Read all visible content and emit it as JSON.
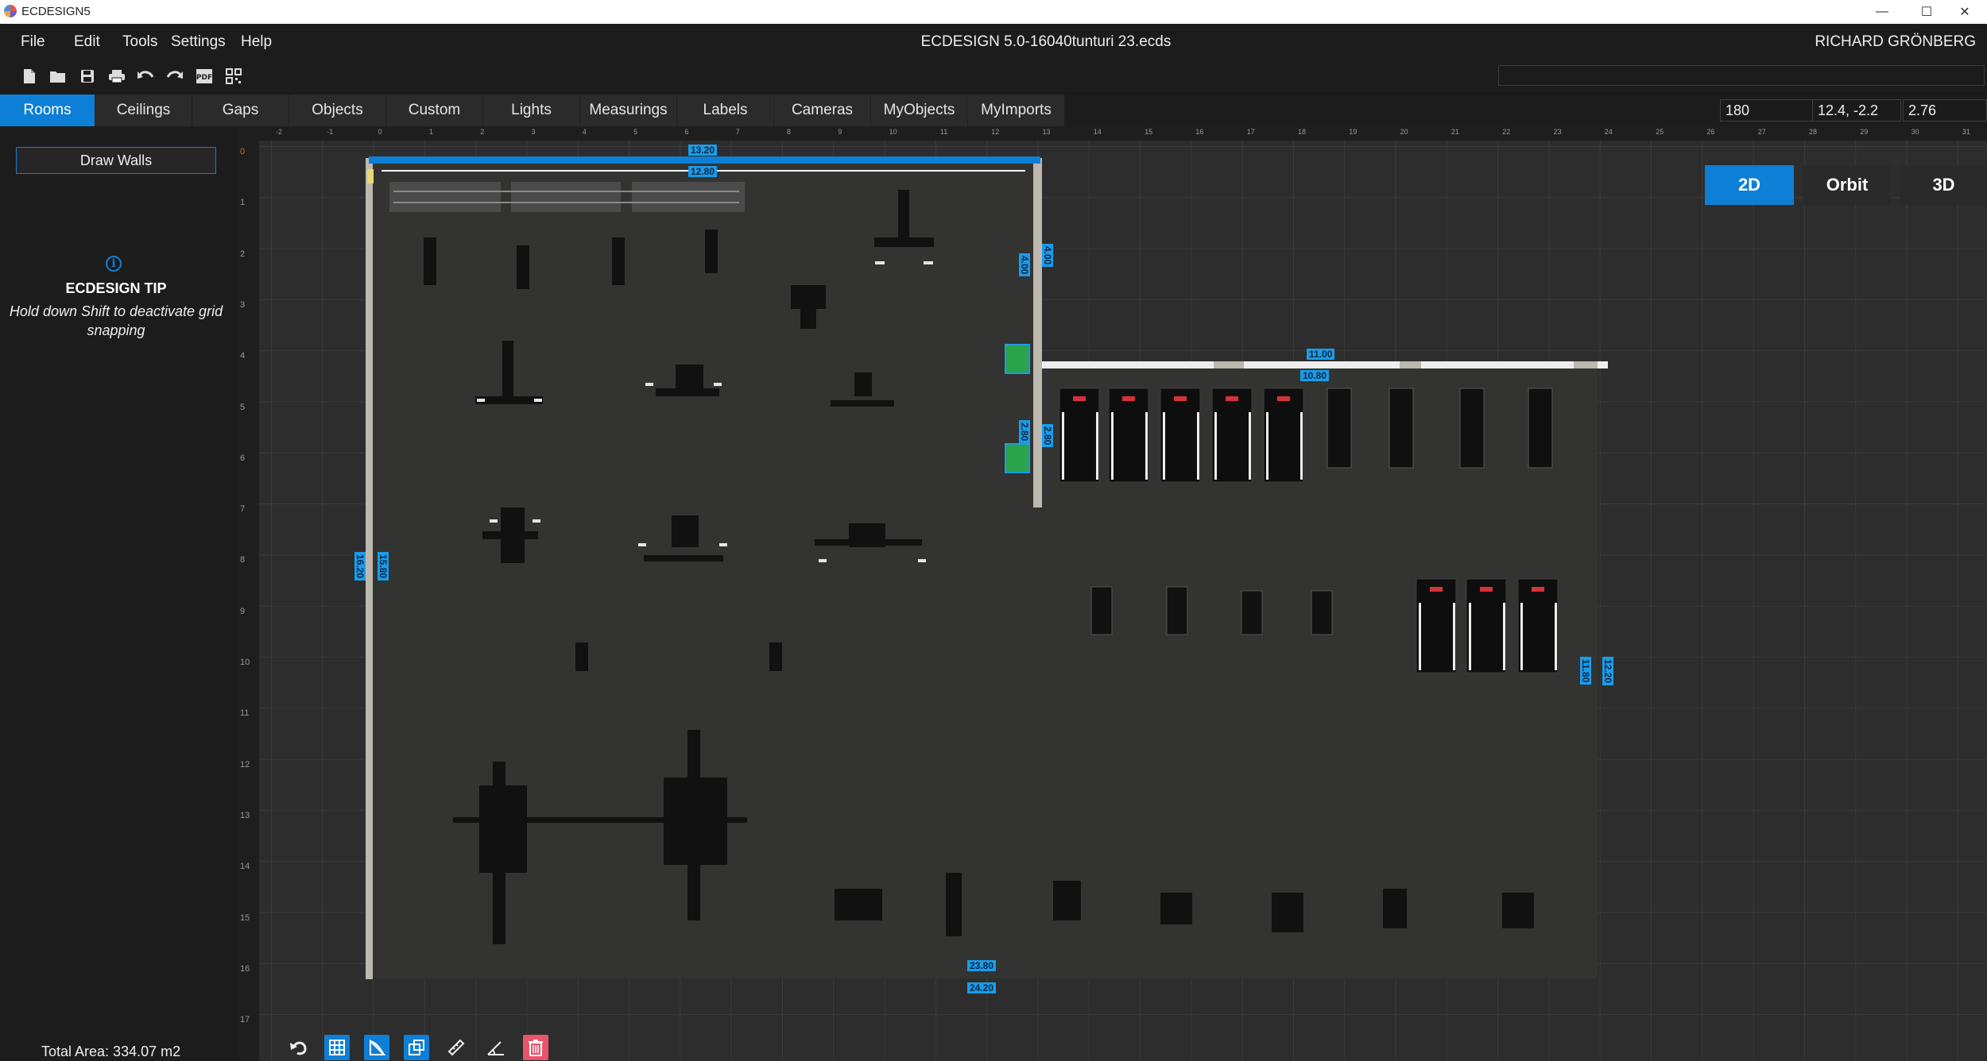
{
  "window": {
    "app_title": "ECDESIGN5",
    "controls": [
      "—",
      "☐",
      "✕"
    ]
  },
  "menu": {
    "items": [
      "File",
      "Edit",
      "Tools",
      "Settings",
      "Help"
    ],
    "document_title": "ECDESIGN 5.0-16040tunturi 23.ecds",
    "user": "RICHARD GRÖNBERG"
  },
  "toolbar": {
    "icons": [
      "new-file-icon",
      "open-folder-icon",
      "save-icon",
      "print-icon",
      "undo-icon",
      "redo-icon",
      "export-pdf-icon",
      "qr-code-icon"
    ]
  },
  "tabs": {
    "items": [
      "Rooms",
      "Ceilings",
      "Gaps",
      "Objects",
      "Custom",
      "Lights",
      "Measurings",
      "Labels",
      "Cameras",
      "MyObjects",
      "MyImports"
    ],
    "active": "Rooms"
  },
  "coords": {
    "rotation": "180",
    "position": "12.4, -2.2",
    "height": "2.76"
  },
  "left_panel": {
    "draw_walls": "Draw Walls",
    "tip_icon": "i",
    "tip_title": "ECDESIGN TIP",
    "tip_body": "Hold down Shift to deactivate grid snapping",
    "total_area": "Total Area: 334.07 m2"
  },
  "view": {
    "buttons": [
      "2D",
      "Orbit",
      "3D"
    ],
    "active": "2D"
  },
  "rulers": {
    "top": [
      "-2",
      "-1",
      "0",
      "1",
      "2",
      "3",
      "4",
      "5",
      "6",
      "7",
      "8",
      "9",
      "10",
      "11",
      "12",
      "13",
      "14",
      "15",
      "16",
      "17",
      "18",
      "19",
      "20",
      "21",
      "22",
      "23",
      "24",
      "25",
      "26",
      "27",
      "28",
      "29",
      "30",
      "31"
    ],
    "left": [
      "0",
      "1",
      "2",
      "3",
      "4",
      "5",
      "6",
      "7",
      "8",
      "9",
      "10",
      "11",
      "12",
      "13",
      "14",
      "15",
      "16",
      "17"
    ]
  },
  "dimensions": {
    "top_outer": "13.20",
    "top_inner": "12.80",
    "right_upper_a": "4.00",
    "right_upper_b": "4.00",
    "mid_outer": "11.00",
    "mid_inner": "10.80",
    "mid_vert_a": "2.80",
    "mid_vert_b": "2.80",
    "left_outer": "16.20",
    "left_inner": "15.80",
    "right_inner": "11.80",
    "right_outer": "12.20",
    "bottom_inner": "23.80",
    "bottom_outer": "24.20"
  },
  "colors": {
    "accent": "#0e7fd6",
    "wall": "#bdb8ae",
    "floor": "#2d2d2d",
    "delete": "#e8556b"
  },
  "bottom_tools": [
    "undo-rotate-icon",
    "grid-toggle-icon",
    "wall-shape-icon",
    "snap-icon",
    "ruler-icon",
    "angle-icon",
    "delete-icon"
  ]
}
